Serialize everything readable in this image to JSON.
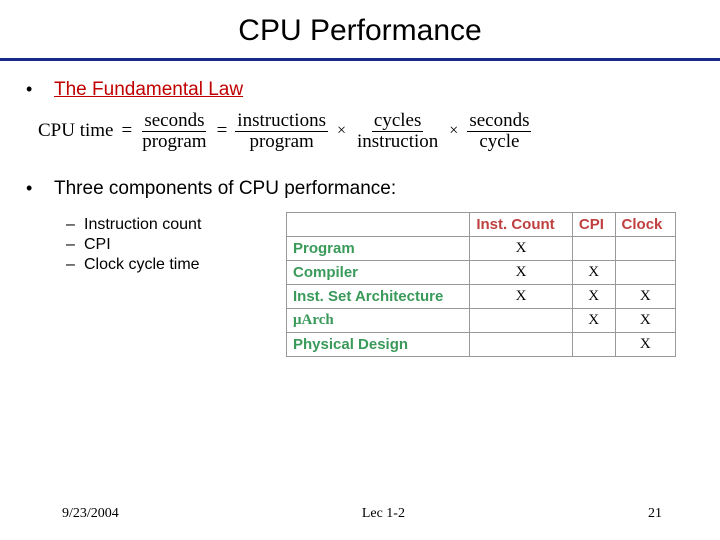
{
  "title": "CPU Performance",
  "bullets": {
    "law": "The Fundamental Law",
    "three": "Three components of CPU performance:"
  },
  "equation": {
    "lhs": "CPU time",
    "eq": "=",
    "f1n": "seconds",
    "f1d": "program",
    "f2n": "instructions",
    "f2d": "program",
    "f3n": "cycles",
    "f3d": "instruction",
    "f4n": "seconds",
    "f4d": "cycle",
    "times": "×"
  },
  "subitems": [
    "Instruction count",
    "CPI",
    "Clock cycle time"
  ],
  "table": {
    "cols": [
      "Inst. Count",
      "CPI",
      "Clock"
    ],
    "rows": [
      {
        "label": "Program",
        "marks": [
          "X",
          "",
          ""
        ]
      },
      {
        "label": "Compiler",
        "marks": [
          "X",
          "X",
          ""
        ]
      },
      {
        "label": "Inst. Set Architecture",
        "marks": [
          "X",
          "X",
          "X"
        ]
      },
      {
        "label": "μArch",
        "marks": [
          "",
          "X",
          "X"
        ]
      },
      {
        "label": "Physical Design",
        "marks": [
          "",
          "",
          "X"
        ]
      }
    ]
  },
  "footer": {
    "date": "9/23/2004",
    "center": "Lec 1-2",
    "page": "21"
  }
}
